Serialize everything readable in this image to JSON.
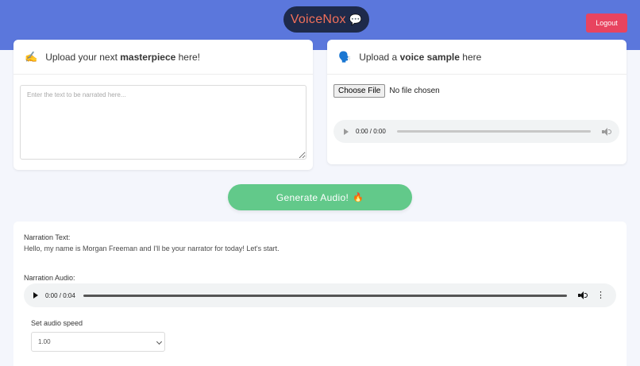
{
  "header": {
    "brand": "VoiceNox",
    "brand_icon": "speech-bubble-icon",
    "logout_label": "Logout",
    "brand_color": "#f2705a",
    "bar_color": "#5b77dc"
  },
  "text_card": {
    "icon": "writing-hand-icon",
    "title_prefix": "Upload your next ",
    "title_bold": "masterpiece",
    "title_suffix": " here!",
    "textarea_placeholder": "Enter the text to be narrated here...",
    "textarea_value": ""
  },
  "voice_card": {
    "icon": "speaking-head-icon",
    "title_prefix": "Upload a ",
    "title_bold": "voice sample",
    "title_suffix": " here",
    "file_button": "Choose File",
    "file_status": "No file chosen",
    "player_time": "0:00 / 0:00"
  },
  "generate": {
    "label": "Generate Audio!",
    "icon": "fire-icon",
    "color": "#62c98a"
  },
  "result": {
    "narration_text_label": "Narration Text:",
    "narration_text": "Hello, my name is Morgan Freeman and I'll be your narrator for today! Let's start.",
    "narration_audio_label": "Narration Audio:",
    "player_time": "0:00 / 0:04",
    "speed_label": "Set audio speed",
    "speed_value": "1.00"
  }
}
